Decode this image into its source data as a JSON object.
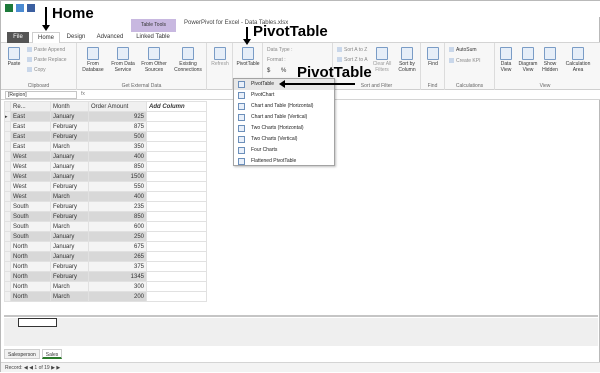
{
  "window": {
    "title": "PowerPivot for Excel - Data Tables.xlsx",
    "contextual_tab": "Table Tools"
  },
  "tabs": [
    "File",
    "Home",
    "Design",
    "Advanced",
    "Linked Table"
  ],
  "ribbon": {
    "clipboard": {
      "label": "Clipboard",
      "paste": "Paste",
      "paste_append": "Paste Append",
      "paste_replace": "Paste Replace",
      "copy": "Copy"
    },
    "get_external_data": {
      "label": "Get External Data",
      "from_database": "From Database",
      "from_data_service": "From Data Service",
      "from_other_sources": "From Other Sources",
      "existing_connections": "Existing Connections"
    },
    "refresh": "Refresh",
    "pivottable": "PivotTable",
    "formatting": {
      "data_type": "Data Type :",
      "format": "Format :",
      "currency": "$",
      "percent": "%"
    },
    "sort_filter": {
      "label": "Sort and Filter",
      "sort_az": "Sort A to Z",
      "sort_za": "Sort Z to A",
      "clear_all_filters": "Clear All Filters",
      "sort_by_column": "Sort by Column"
    },
    "find": {
      "label": "Find",
      "find": "Find"
    },
    "calculations": {
      "label": "Calculations",
      "autosum": "AutoSum",
      "create_kpi": "Create KPI"
    },
    "view": {
      "label": "View",
      "data_view": "Data View",
      "diagram_view": "Diagram View",
      "show_hidden": "Show Hidden",
      "calculation_area": "Calculation Area"
    }
  },
  "formula_bar": {
    "name_box": "[Region]",
    "fx": "fx"
  },
  "table": {
    "headers": [
      "Re...",
      "Month",
      "Order Amount",
      "Add Column"
    ],
    "rows": [
      [
        "East",
        "January",
        "925"
      ],
      [
        "East",
        "February",
        "875"
      ],
      [
        "East",
        "February",
        "500"
      ],
      [
        "East",
        "March",
        "350"
      ],
      [
        "West",
        "January",
        "400"
      ],
      [
        "West",
        "January",
        "850"
      ],
      [
        "West",
        "January",
        "1500"
      ],
      [
        "West",
        "February",
        "550"
      ],
      [
        "West",
        "March",
        "400"
      ],
      [
        "South",
        "February",
        "235"
      ],
      [
        "South",
        "February",
        "850"
      ],
      [
        "South",
        "March",
        "600"
      ],
      [
        "South",
        "January",
        "250"
      ],
      [
        "North",
        "January",
        "675"
      ],
      [
        "North",
        "January",
        "265"
      ],
      [
        "North",
        "February",
        "375"
      ],
      [
        "North",
        "February",
        "1345"
      ],
      [
        "North",
        "March",
        "300"
      ],
      [
        "North",
        "March",
        "200"
      ]
    ]
  },
  "dropdown": [
    "PivotTable",
    "PivotChart",
    "Chart and Table (Horizontal)",
    "Chart and Table (Vertical)",
    "Two Charts (Horizontal)",
    "Two Charts (Vertical)",
    "Four Charts",
    "Flattened PivotTable"
  ],
  "sheets": [
    "Salesperson",
    "Sales"
  ],
  "status": {
    "record": "Record:",
    "position": "1 of 19"
  },
  "annotations": {
    "home": "Home",
    "pivottable_ribbon": "PivotTable",
    "pivottable_menu": "PivotTable"
  }
}
